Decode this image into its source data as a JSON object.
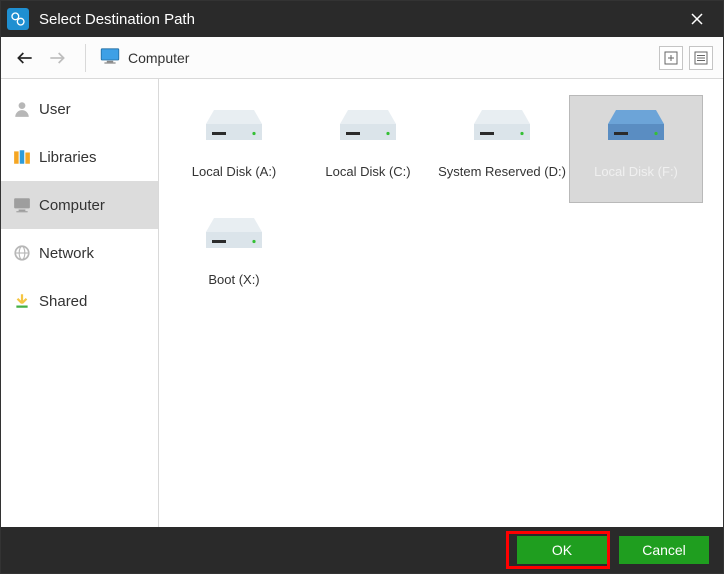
{
  "window": {
    "title": "Select Destination Path"
  },
  "toolbar": {
    "path_label": "Computer"
  },
  "sidebar": {
    "items": [
      {
        "label": "User",
        "icon": "user-icon"
      },
      {
        "label": "Libraries",
        "icon": "libraries-icon"
      },
      {
        "label": "Computer",
        "icon": "computer-icon"
      },
      {
        "label": "Network",
        "icon": "network-icon"
      },
      {
        "label": "Shared",
        "icon": "shared-icon"
      }
    ],
    "selected_index": 2
  },
  "drives": [
    {
      "label": "Local Disk (A:)",
      "selected": false
    },
    {
      "label": "Local Disk (C:)",
      "selected": false
    },
    {
      "label": "System Reserved (D:)",
      "selected": false
    },
    {
      "label": "Local Disk (F:)",
      "selected": true
    },
    {
      "label": "Boot (X:)",
      "selected": false
    }
  ],
  "footer": {
    "ok_label": "OK",
    "cancel_label": "Cancel"
  }
}
